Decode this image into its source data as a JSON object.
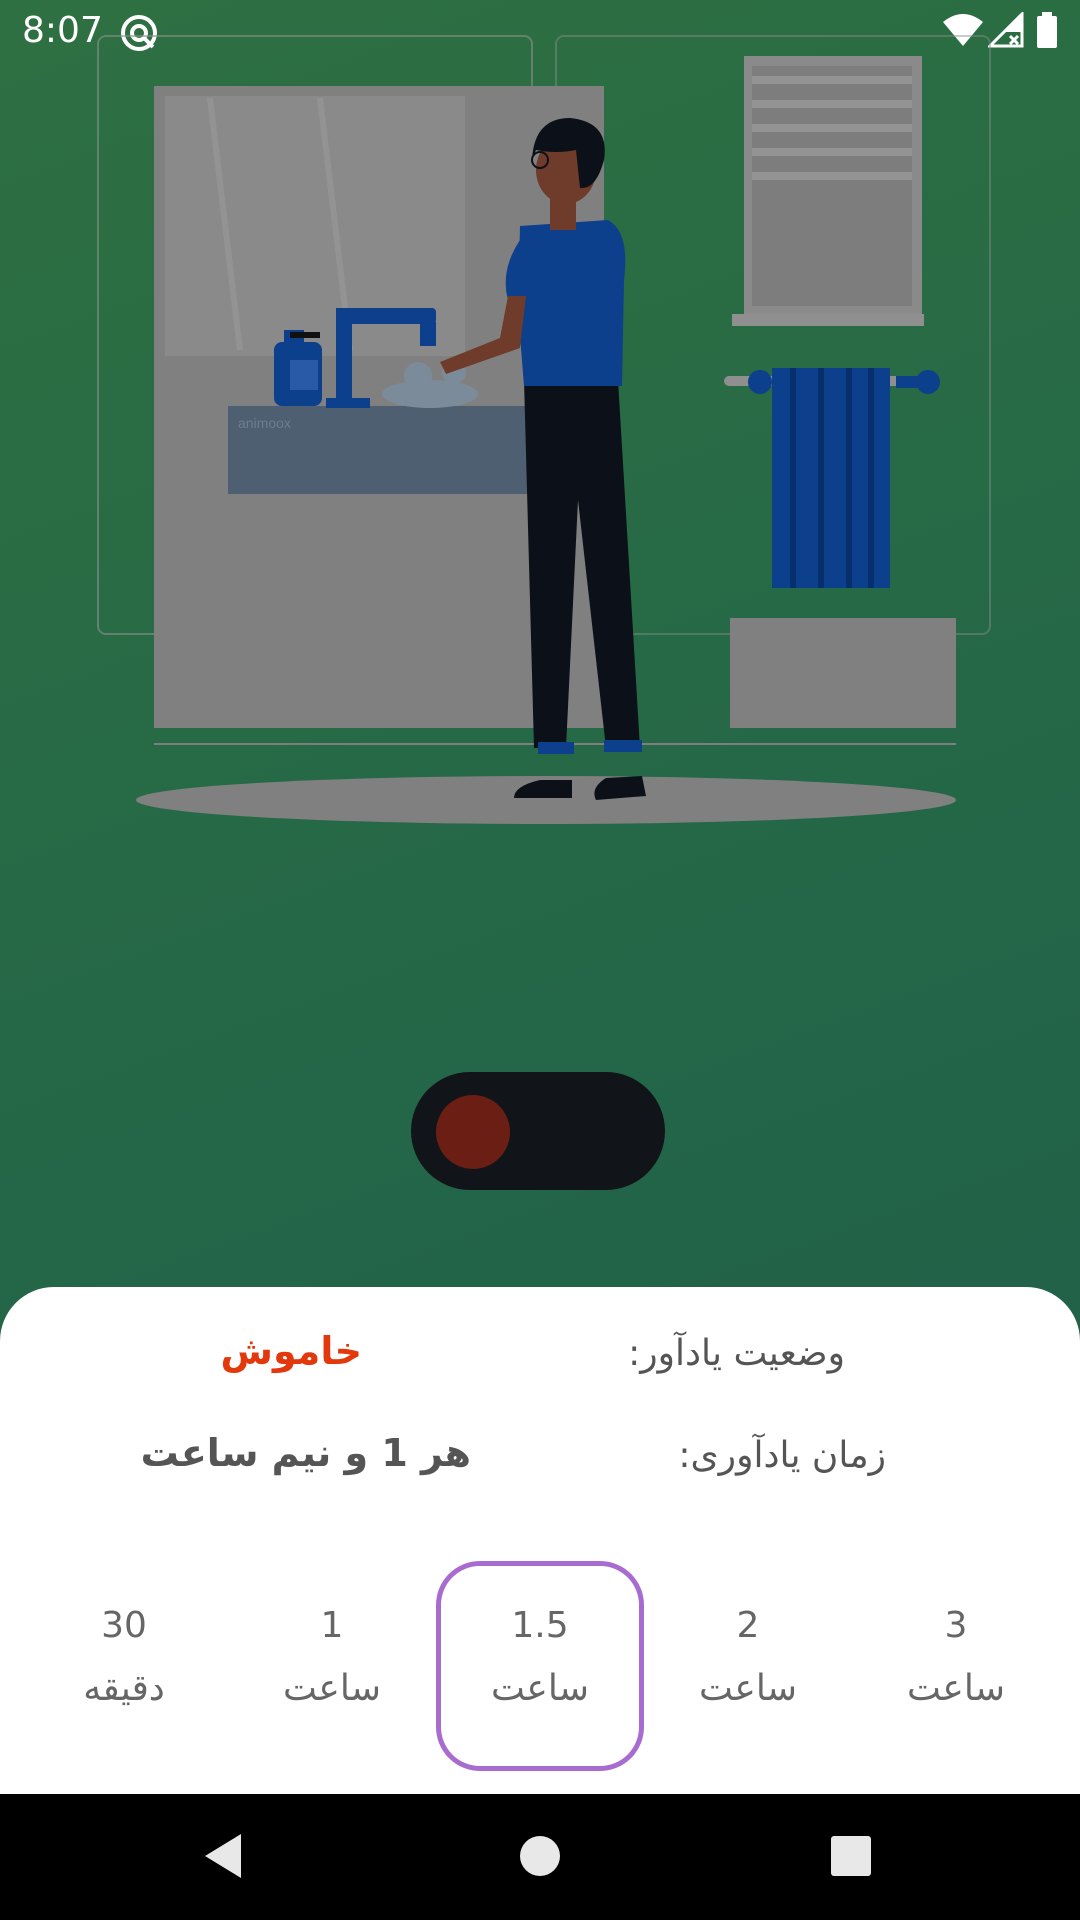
{
  "status_bar": {
    "time": "8:07",
    "icons": [
      "app-notification-icon",
      "wifi-icon",
      "signal-icon",
      "battery-icon"
    ]
  },
  "illustration": {
    "watermark": "animoox"
  },
  "toggle": {
    "state": "off",
    "knob_color": "#6b1f14"
  },
  "reminder": {
    "status_label": "وضعیت یادآور:",
    "status_value": "خاموش",
    "status_color": "#e2380b",
    "time_label": "زمان یادآوری:",
    "time_value": "هر 1 و نیم ساعت"
  },
  "interval_options": [
    {
      "value": "30",
      "unit": "دقیقه",
      "selected": false
    },
    {
      "value": "1",
      "unit": "ساعت",
      "selected": false
    },
    {
      "value": "1.5",
      "unit": "ساعت",
      "selected": true
    },
    {
      "value": "2",
      "unit": "ساعت",
      "selected": false
    },
    {
      "value": "3",
      "unit": "ساعت",
      "selected": false
    }
  ],
  "nav_bar": {
    "buttons": [
      "back-icon",
      "home-icon",
      "recents-icon"
    ]
  },
  "colors": {
    "background_start": "#2e7041",
    "background_end": "#1d5c4a",
    "selected_border": "#a86cd1"
  }
}
